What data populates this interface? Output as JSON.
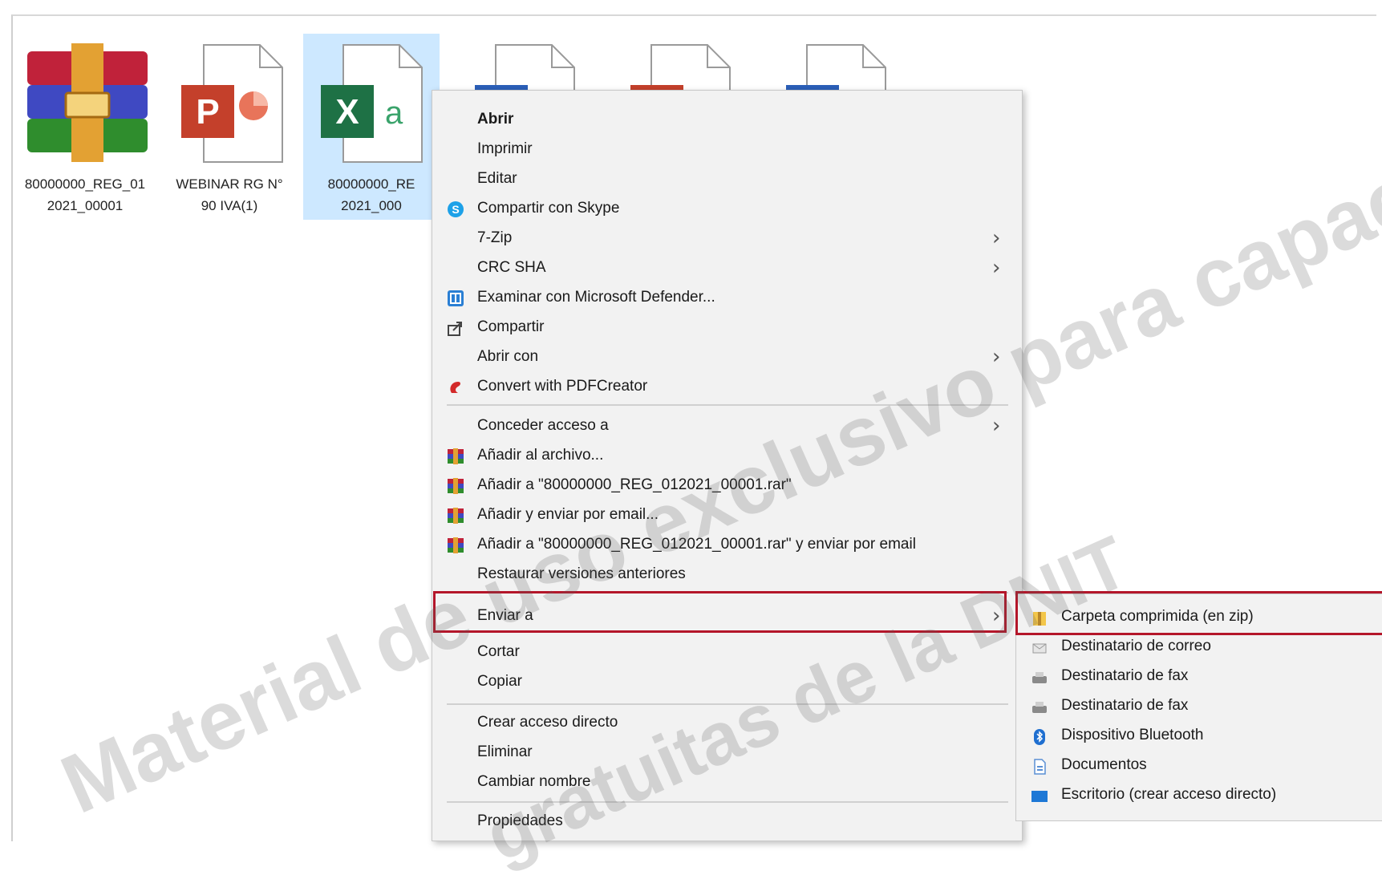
{
  "files": [
    {
      "icon": "winrar-archive-icon",
      "label_line1": "80000000_REG_01",
      "label_line2": "2021_00001"
    },
    {
      "icon": "powerpoint-file-icon",
      "label_line1": "WEBINAR RG N°",
      "label_line2": "90 IVA(1)"
    },
    {
      "icon": "excel-file-icon",
      "label_line1": "80000000_RE",
      "label_line2": "2021_000"
    },
    {
      "icon": "word-file-icon"
    },
    {
      "icon": "powerpoint-file-icon"
    },
    {
      "icon": "word-file-icon"
    }
  ],
  "context_menu": {
    "items": [
      {
        "label": "Abrir"
      },
      {
        "label": "Imprimir"
      },
      {
        "label": "Editar"
      },
      {
        "label": "Compartir con Skype",
        "icon": "skype-icon"
      },
      {
        "label": "7-Zip"
      },
      {
        "label": "CRC SHA"
      },
      {
        "label": "Examinar con Microsoft Defender...",
        "icon": "defender-icon"
      },
      {
        "label": "Compartir",
        "icon": "share-icon"
      },
      {
        "label": "Abrir con"
      },
      {
        "label": "Convert with PDFCreator",
        "icon": "pdfcreator-icon"
      },
      {
        "label": "Conceder acceso a"
      },
      {
        "label": "Añadir al archivo...",
        "icon": "winrar-icon"
      },
      {
        "label": "Añadir a \"80000000_REG_012021_00001.rar\"",
        "icon": "winrar-icon"
      },
      {
        "label": "Añadir y enviar por email...",
        "icon": "winrar-icon"
      },
      {
        "label": "Añadir a \"80000000_REG_012021_00001.rar\" y enviar por email",
        "icon": "winrar-icon"
      },
      {
        "label": "Restaurar versiones anteriores"
      },
      {
        "label": "Enviar a"
      },
      {
        "label": "Cortar"
      },
      {
        "label": "Copiar"
      },
      {
        "label": "Crear acceso directo"
      },
      {
        "label": "Eliminar"
      },
      {
        "label": "Cambiar nombre"
      },
      {
        "label": "Propiedades"
      }
    ]
  },
  "send_to_submenu": {
    "items": [
      {
        "label": "Carpeta comprimida (en zip)",
        "icon": "zip-folder-icon"
      },
      {
        "label": "Destinatario de correo",
        "icon": "mail-icon"
      },
      {
        "label": "Destinatario de fax",
        "icon": "fax-icon"
      },
      {
        "label": "Destinatario de fax",
        "icon": "fax-icon"
      },
      {
        "label": "Dispositivo Bluetooth",
        "icon": "bluetooth-icon"
      },
      {
        "label": "Documentos",
        "icon": "documents-icon"
      },
      {
        "label": "Escritorio (crear acceso directo)",
        "icon": "desktop-icon"
      }
    ]
  },
  "watermark": {
    "line1": "Material de uso exclusivo para capacitacio",
    "line2": "gratuitas de la DNIT"
  },
  "colors": {
    "selection": "#cde8ff",
    "highlight_border": "#b4162a",
    "menu_bg": "#f2f2f2"
  }
}
